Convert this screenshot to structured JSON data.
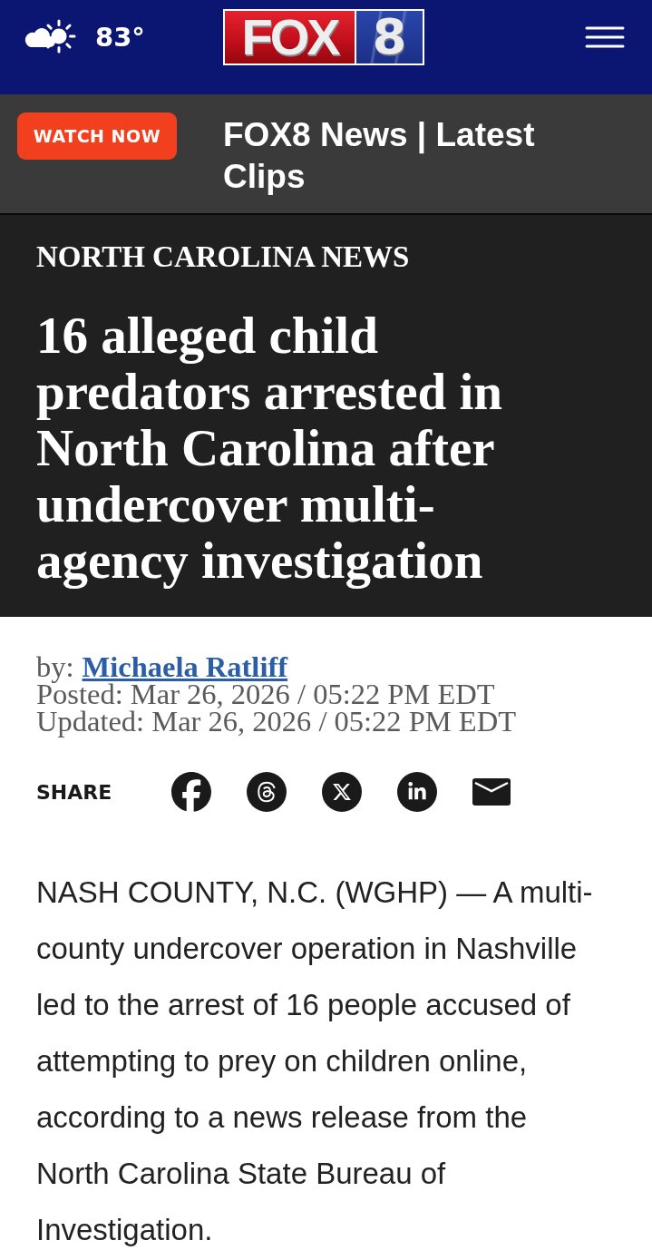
{
  "header": {
    "weather": {
      "temperature": "83°"
    },
    "logo": {
      "wordmark": "FOX",
      "numeral": "8"
    }
  },
  "watch_bar": {
    "button": "WATCH NOW",
    "title": "FOX8 News | Latest Clips"
  },
  "article": {
    "category": "NORTH CAROLINA NEWS",
    "headline": "16 alleged child predators arrested in North Carolina after undercover multi-agency investigation",
    "byline": {
      "prefix": "by:",
      "author": "Michaela Ratliff"
    },
    "posted": "Posted: Mar 26, 2026 / 05:22 PM EDT",
    "updated": "Updated: Mar 26, 2026 / 05:22 PM EDT",
    "share": {
      "label": "SHARE",
      "buttons": [
        {
          "kind": "facebook"
        },
        {
          "kind": "threads"
        },
        {
          "kind": "x"
        },
        {
          "kind": "linkedin"
        },
        {
          "kind": "email"
        }
      ]
    },
    "body": "NASH COUNTY, N.C. (WGHP) — A multi-county undercover operation in Nashville led to the arrest of 16 people accused of attempting to prey on children online, according to a news release from the North Carolina State Bureau of Investigation."
  }
}
